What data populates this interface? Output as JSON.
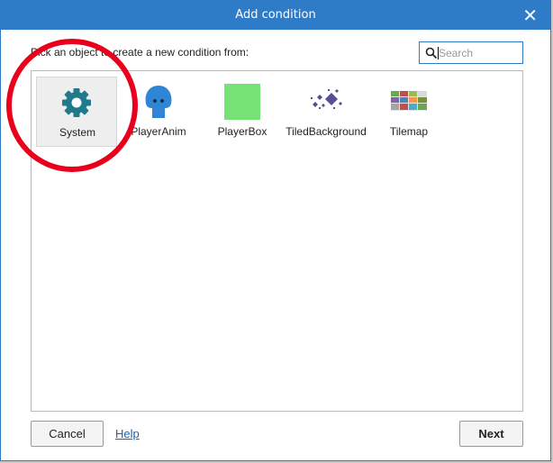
{
  "dialog": {
    "title": "Add condition",
    "close_glyph": "✕",
    "prompt": "Pick an object to create a new condition from:"
  },
  "search": {
    "placeholder": "Search",
    "icon": "search-icon"
  },
  "objects": [
    {
      "label": "System",
      "icon": "gear-icon",
      "selected": true
    },
    {
      "label": "PlayerAnim",
      "icon": "sprite-character-icon"
    },
    {
      "label": "PlayerBox",
      "icon": "green-square-icon"
    },
    {
      "label": "TiledBackground",
      "icon": "tiled-background-icon"
    },
    {
      "label": "Tilemap",
      "icon": "tilemap-icon"
    }
  ],
  "footer": {
    "cancel_label": "Cancel",
    "help_label": "Help",
    "next_label": "Next"
  },
  "colors": {
    "accent": "#2e7cc8",
    "gear": "#1f7a8c",
    "annotation": "#e8001c"
  }
}
